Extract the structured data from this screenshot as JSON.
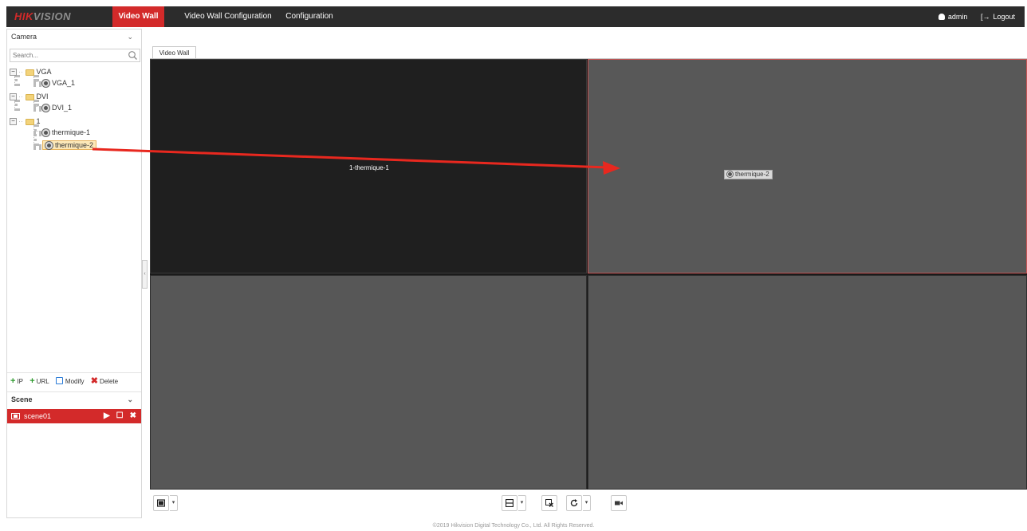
{
  "header": {
    "logo_red": "HIK",
    "logo_rest": "VISION",
    "tabs": [
      {
        "label": "Video Wall",
        "active": true
      },
      {
        "label": "Video Wall Configuration",
        "active": false
      },
      {
        "label": "Configuration",
        "active": false
      }
    ],
    "user": "admin",
    "logout": "Logout"
  },
  "camera_panel": {
    "title": "Camera",
    "search_placeholder": "Search...",
    "tree": [
      {
        "label": "VGA",
        "type": "folder"
      },
      {
        "label": "VGA_1",
        "type": "camera"
      },
      {
        "label": "DVI",
        "type": "folder"
      },
      {
        "label": "DVI_1",
        "type": "camera"
      },
      {
        "label": "1",
        "type": "folder"
      },
      {
        "label": "thermique-1",
        "type": "camera"
      },
      {
        "label": "thermique-2",
        "type": "camera",
        "selected": true
      }
    ],
    "actions": {
      "ip": "IP",
      "url": "URL",
      "modify": "Modify",
      "delete": "Delete"
    }
  },
  "scene_panel": {
    "title": "Scene",
    "items": [
      {
        "label": "scene01"
      }
    ]
  },
  "video_wall": {
    "tab_label": "Video Wall",
    "screens": [
      {
        "label": "1-thermique-1"
      },
      {
        "label": ""
      },
      {
        "label": ""
      },
      {
        "label": ""
      }
    ],
    "drag_label": "thermique-2"
  },
  "footer": "©2019 Hikvision Digital Technology Co., Ltd. All Rights Reserved.",
  "colors": {
    "accent": "#d32a2a",
    "topbar": "#2c2c2c",
    "active_screen": "#1f1f1f",
    "idle_screen": "#585858"
  }
}
